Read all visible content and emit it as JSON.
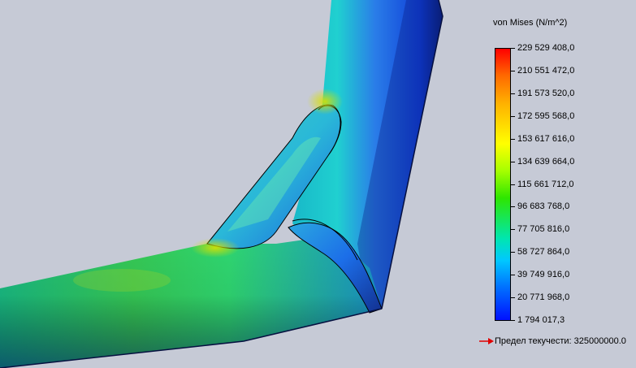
{
  "legend": {
    "title": "von Mises (N/m^2)",
    "labels": [
      "229 529 408,0",
      "210 551 472,0",
      "191 573 520,0",
      "172 595 568,0",
      "153 617 616,0",
      "134 639 664,0",
      "115 661 712,0",
      "96 683 768,0",
      "77 705 816,0",
      "58 727 864,0",
      "39 749 916,0",
      "20 771 968,0",
      "1 794 017,3"
    ],
    "max_color": "#ff0000",
    "min_color": "#0010ff"
  },
  "yield": {
    "text": "Предел текучести: 325000000.0",
    "arrow_color": "#e00000"
  }
}
